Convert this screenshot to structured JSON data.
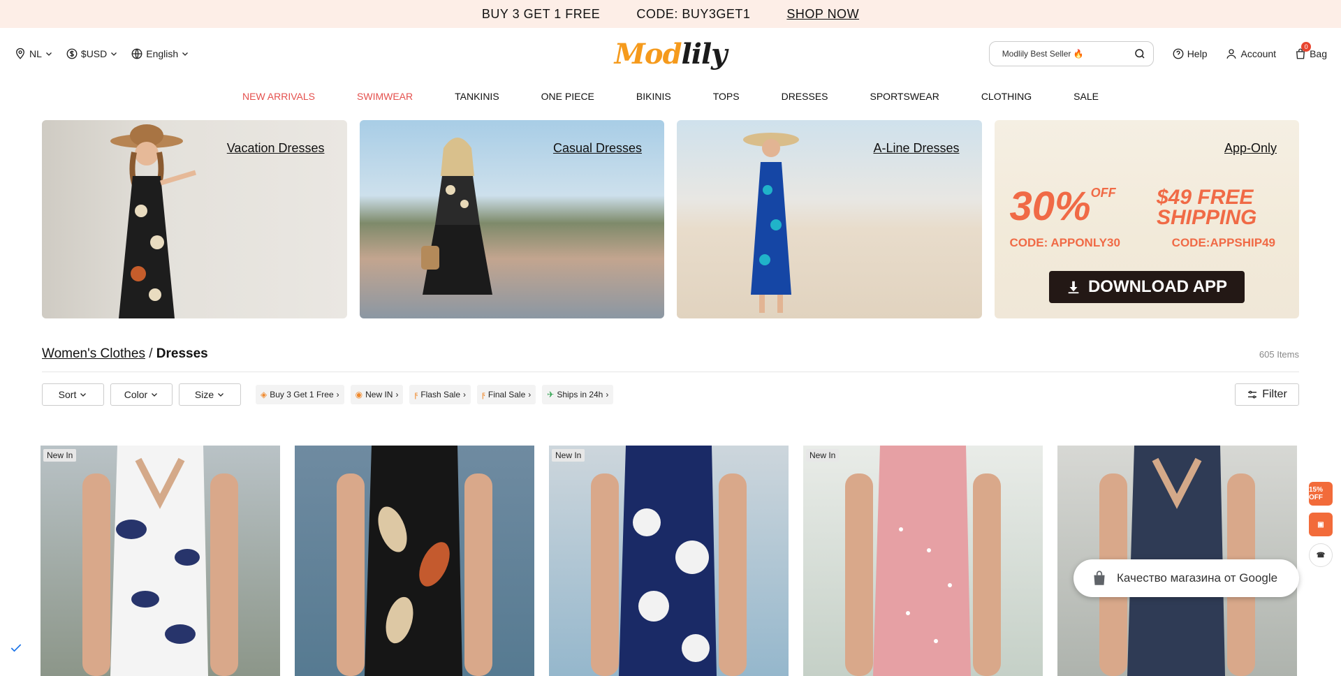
{
  "promo": {
    "offer": "BUY 3 GET 1 FREE",
    "code": "CODE: BUY3GET1",
    "shop_link": "SHOP NOW"
  },
  "header": {
    "location": "NL",
    "currency": "$USD",
    "language": "English",
    "logo_part1": "Mod",
    "logo_part2": "lily",
    "search_query": "Modlily Best Seller",
    "help_label": "Help",
    "account_label": "Account",
    "bag_label": "Bag",
    "bag_count": "0"
  },
  "nav": {
    "items": [
      "NEW ARRIVALS",
      "SWIMWEAR",
      "TANKINIS",
      "ONE PIECE",
      "BIKINIS",
      "TOPS",
      "DRESSES",
      "SPORTSWEAR",
      "CLOTHING",
      "SALE"
    ]
  },
  "banners": {
    "vacation": "Vacation Dresses",
    "casual": "Casual Dresses",
    "aline": "A-Line Dresses",
    "app": {
      "label": "App-Only",
      "discount": "30%",
      "off": "OFF",
      "free_shipping": "$49 FREE SHIPPING",
      "code1": "CODE: APPONLY30",
      "code2": "CODE:APPSHIP49",
      "download": "DOWNLOAD APP"
    }
  },
  "breadcrumb": {
    "parent": "Women's Clothes",
    "separator": " / ",
    "current": "Dresses",
    "count": "605 Items"
  },
  "filters": {
    "sort": "Sort",
    "color": "Color",
    "size": "Size",
    "chips": [
      "Buy 3 Get 1 Free",
      "New IN",
      "Flash Sale",
      "Final Sale",
      "Ships in 24h"
    ],
    "filter_button": "Filter"
  },
  "products": {
    "tags": [
      "New In",
      "",
      "New In",
      "New In",
      ""
    ]
  },
  "side": {
    "discount_badge": "15% OFF"
  },
  "google_badge": "Качество магазина от Google",
  "colors": {
    "promo_bg": "#fdeee7",
    "accent_red": "#e4504d",
    "logo_orange": "#f59a1c",
    "app_orange": "#f06a46"
  }
}
